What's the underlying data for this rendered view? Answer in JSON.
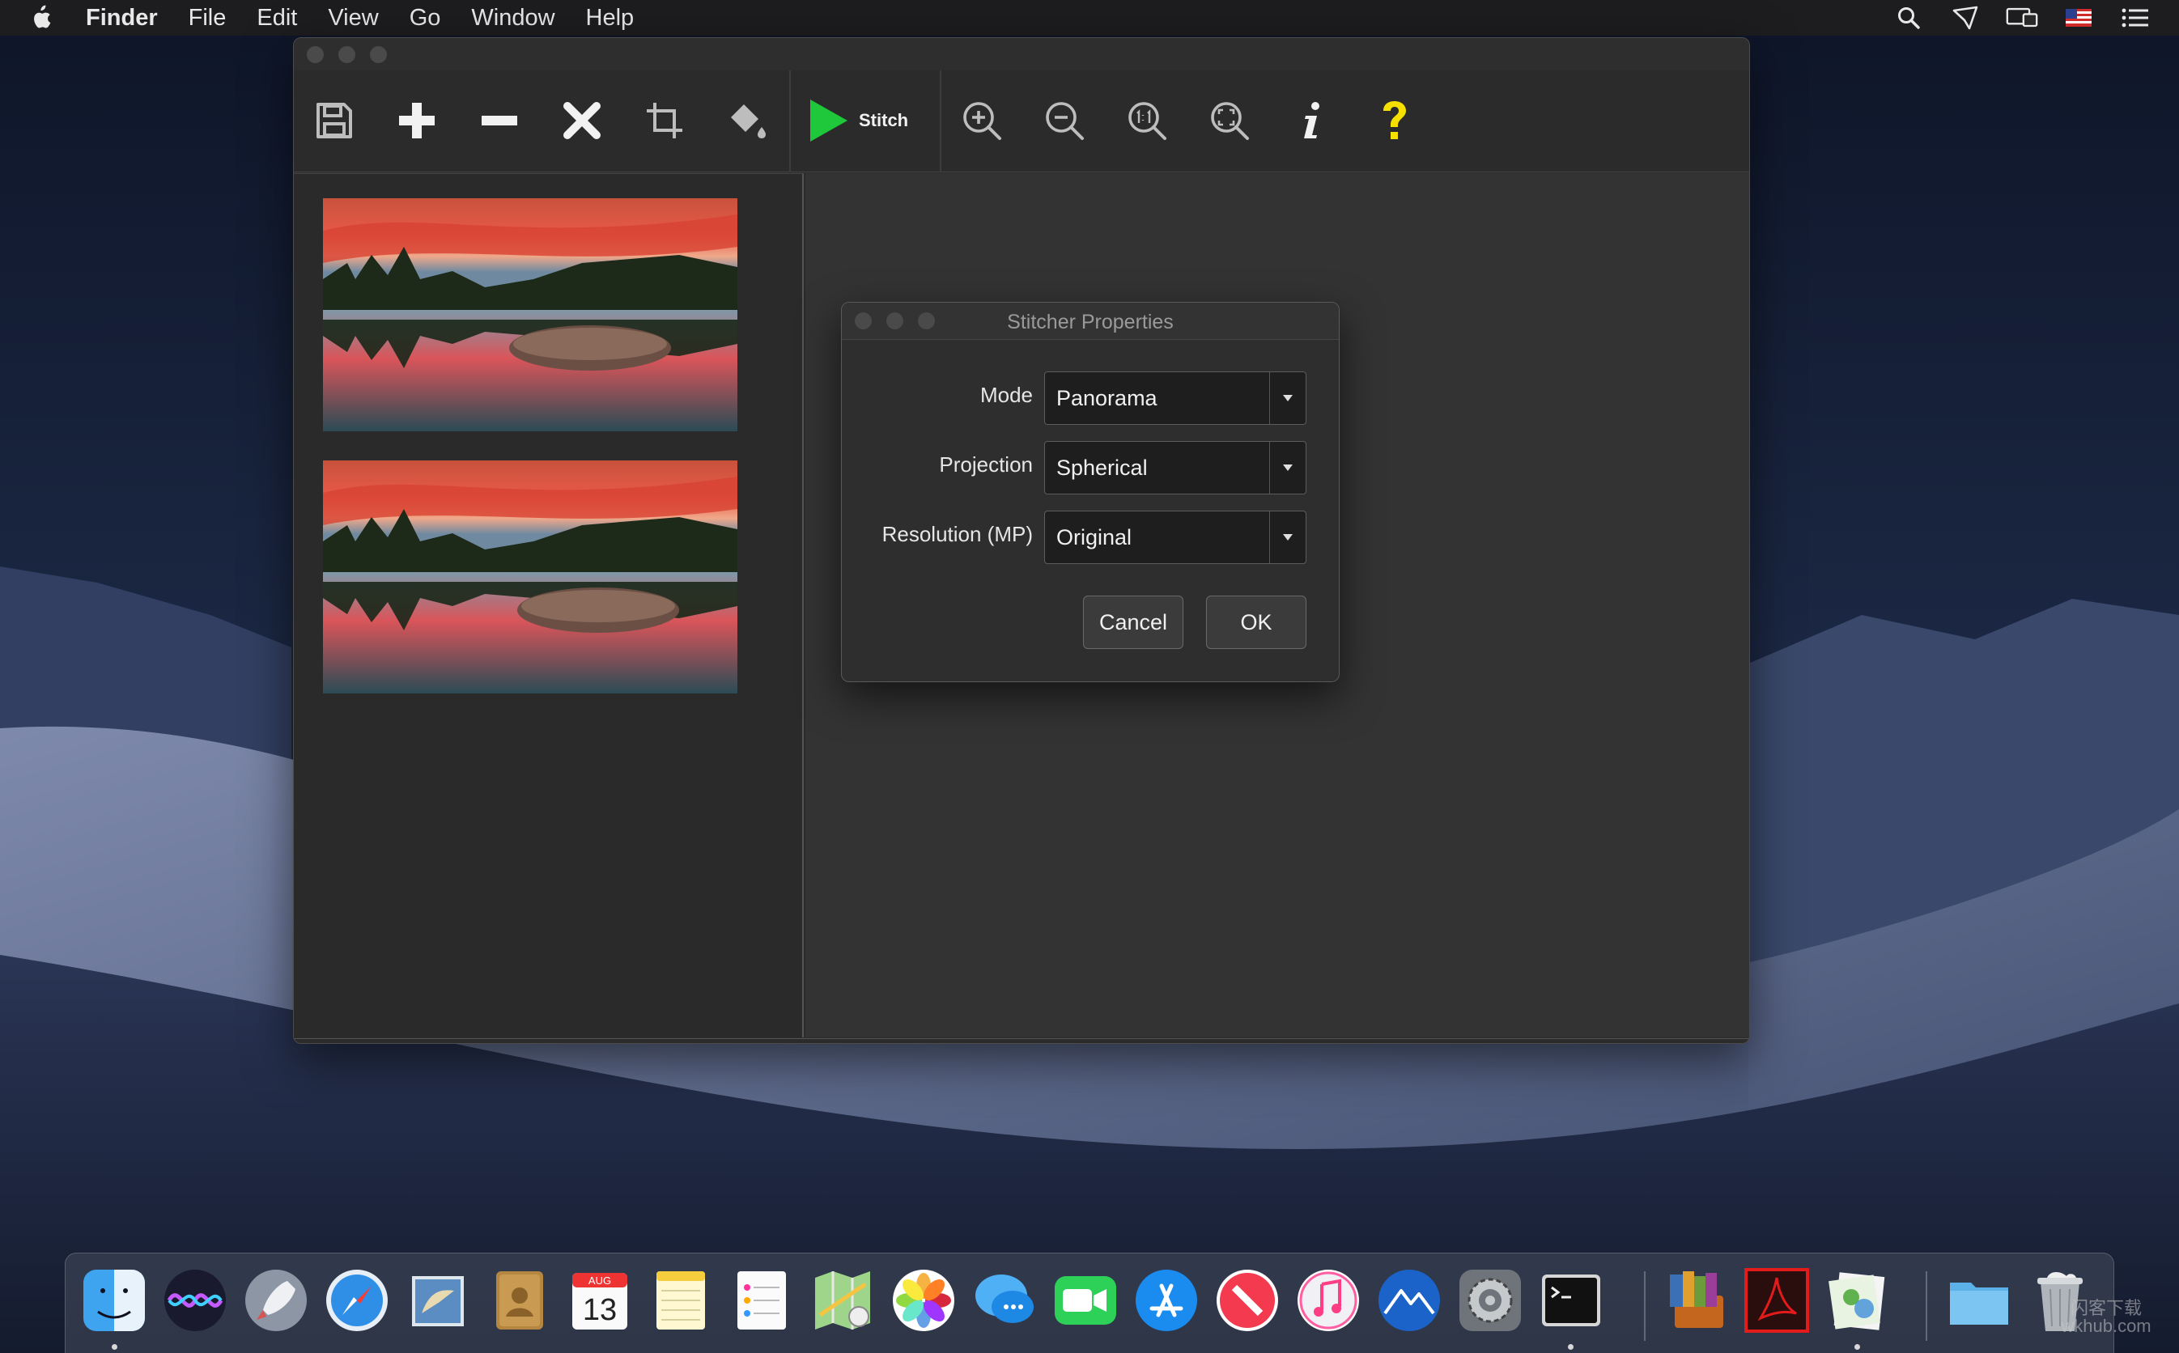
{
  "menubar": {
    "app_name": "Finder",
    "items": [
      "File",
      "Edit",
      "View",
      "Go",
      "Window",
      "Help"
    ],
    "status_icons": [
      "search-icon",
      "airplay-icon",
      "display-icon",
      "us-flag-icon",
      "list-icon"
    ]
  },
  "app": {
    "toolbar": {
      "buttons": [
        "save-icon",
        "add-icon",
        "remove-icon",
        "delete-icon",
        "crop-icon",
        "fill-icon",
        "zoom-in-icon",
        "zoom-out-icon",
        "zoom-1to1-icon",
        "zoom-fit-icon",
        "info-icon",
        "help-icon"
      ],
      "stitch_label": "Stitch"
    },
    "thumbnails": [
      "lake-sunset-1",
      "lake-sunset-2"
    ]
  },
  "dialog": {
    "title": "Stitcher Properties",
    "mode_label": "Mode",
    "mode_value": "Panorama",
    "projection_label": "Projection",
    "projection_value": "Spherical",
    "resolution_label": "Resolution (MP)",
    "resolution_value": "Original",
    "cancel_label": "Cancel",
    "ok_label": "OK"
  },
  "dock": {
    "apps": [
      "finder",
      "siri",
      "launchpad",
      "safari",
      "mail",
      "contacts",
      "calendar",
      "notes",
      "reminders",
      "maps",
      "photos",
      "messages",
      "facetime",
      "app-store",
      "news",
      "itunes",
      "instruments",
      "system-preferences",
      "terminal",
      "librarian",
      "acrobat",
      "preview",
      "downloads",
      "trash"
    ],
    "calendar": {
      "month": "AUG",
      "day": "13"
    }
  },
  "watermark": "闪客下载 wkhub.com",
  "colors": {
    "stitch_green": "#1fc83a",
    "help_yellow": "#f5e000",
    "window_bg": "#2b2b2b",
    "canvas_bg": "#333333"
  }
}
